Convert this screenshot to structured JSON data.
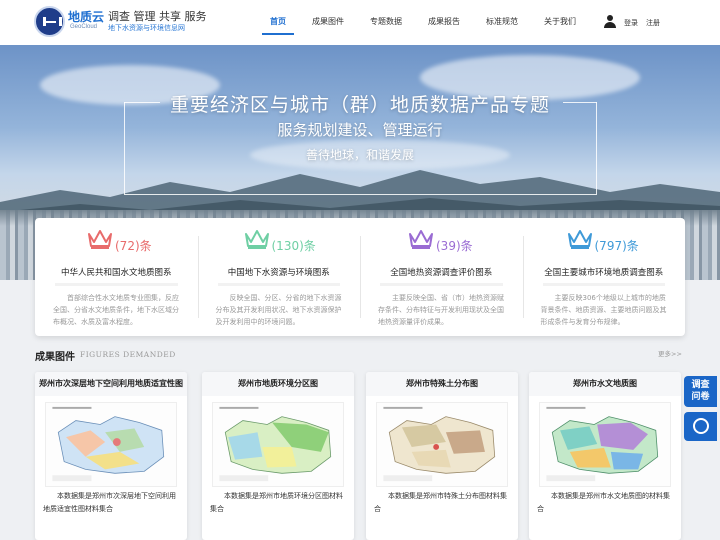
{
  "brand": {
    "logo_text": "地质云",
    "logo_sub": "GeoCloud",
    "slogan": "调查 管理 共享 服务",
    "slogan_sub": "地下水资源与环境信息网"
  },
  "nav": {
    "items": [
      "首页",
      "成果图件",
      "专题数据",
      "成果报告",
      "标准规范",
      "关于我们"
    ],
    "active_index": 0
  },
  "auth": {
    "login": "登录",
    "register": "注册"
  },
  "banner": {
    "title": "重要经济区与城市（群）地质数据产品专题",
    "subtitle": "服务规划建设、管理运行",
    "tagline": "善待地球，和谐发展"
  },
  "categories": [
    {
      "count": "(72)条",
      "title": "中华人民共和国水文地质图系",
      "desc": "首部综合性水文地质专业图集，反应全国、分省水文地质条件，地下水区域分布概况、水质及富水程度。",
      "color": "#e86b6b"
    },
    {
      "count": "(130)条",
      "title": "中国地下水资源与环境图系",
      "desc": "反映全国、分区、分省的地下水资源分布及其开发利用状况、地下水资源保护及开发利用中的环境问题。",
      "color": "#6fcfa4"
    },
    {
      "count": "(39)条",
      "title": "全国地热资源调查评价图系",
      "desc": "主要反映全国、省（市）地热资源赋存条件、分布特征与开发利用现状及全国地热资源量评价成果。",
      "color": "#9a6cd3"
    },
    {
      "count": "(797)条",
      "title": "全国主要城市环境地质调查图系",
      "desc": "主要反映306个地级以上城市的地质背景条件、地质资源、主要地质问题及其形成条件与发育分布规律。",
      "color": "#3f9ad8"
    }
  ],
  "section": {
    "title": "成果图件",
    "title_en": "FIGURES DEMANDED",
    "more": "更多>>"
  },
  "maps": [
    {
      "title": "郑州市次深层地下空间利用地质适宜性图",
      "desc": "本数据集是郑州市次深层地下空间利用地质适宜性图材料集合"
    },
    {
      "title": "郑州市地质环境分区图",
      "desc": "本数据集是郑州市地质环境分区图材料集合"
    },
    {
      "title": "郑州市特殊土分布图",
      "desc": "本数据集是郑州市特殊土分布图材料集合"
    },
    {
      "title": "郑州市水文地质图",
      "desc": "本数据集是郑州市水文地质图的材料集合"
    }
  ],
  "side": {
    "survey": "调查问卷",
    "qq_icon": "qq-icon"
  }
}
